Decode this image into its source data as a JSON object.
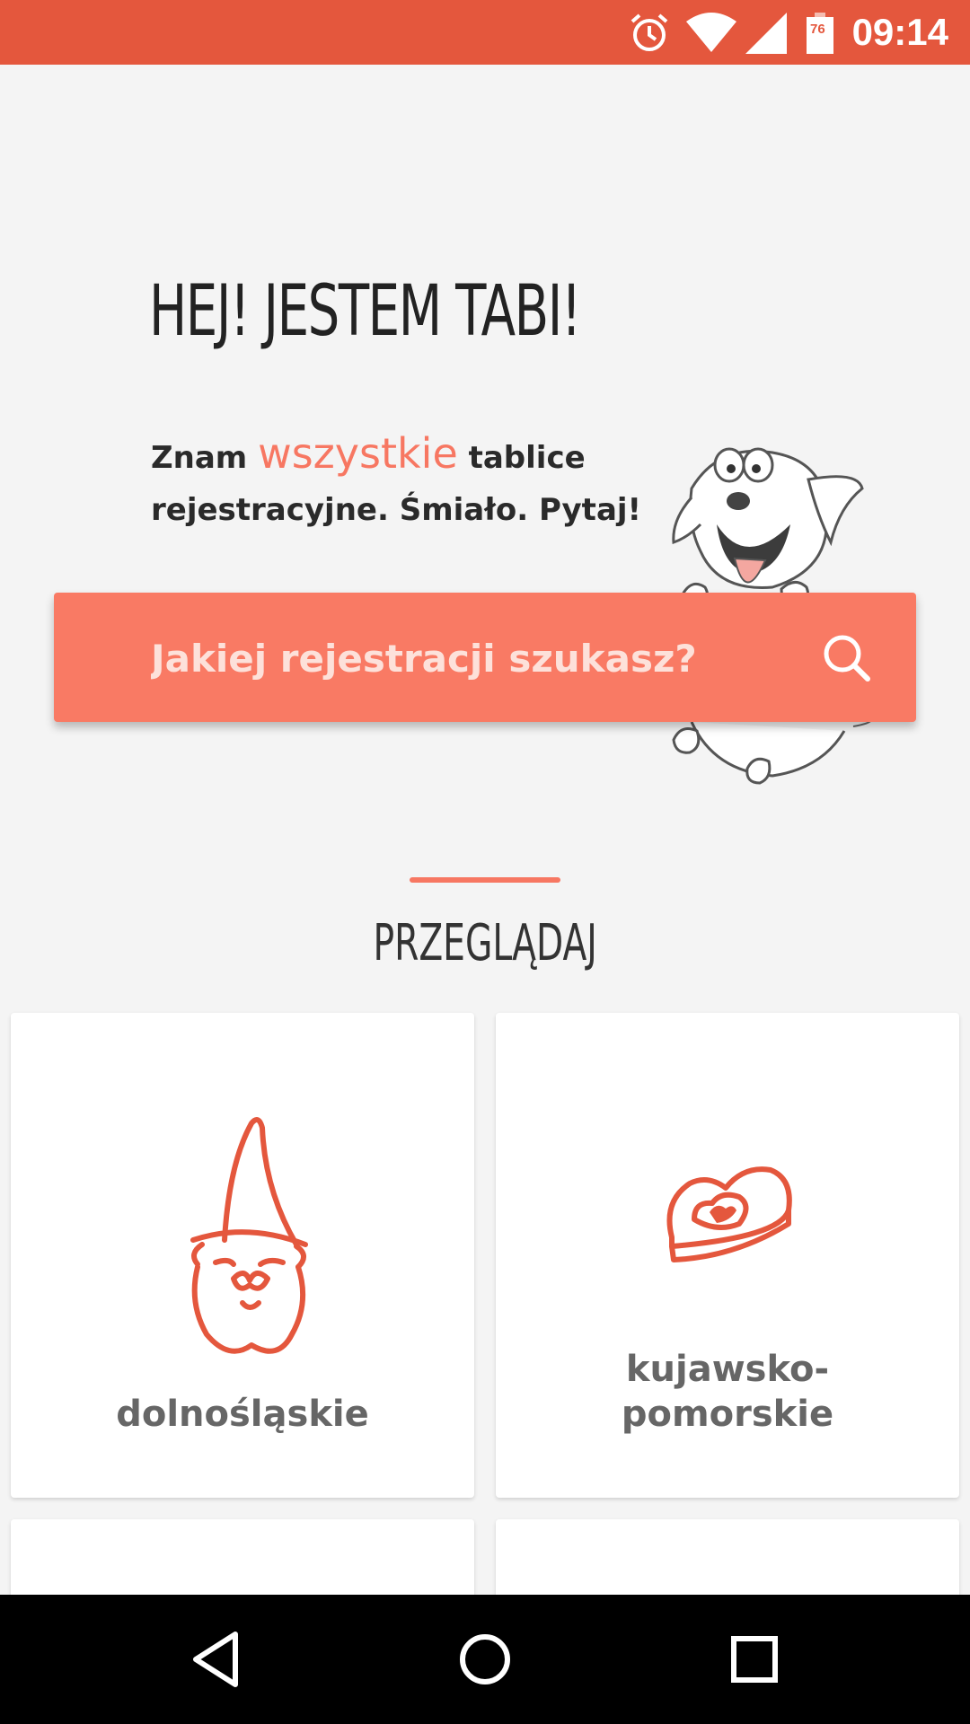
{
  "status_bar": {
    "time": "09:14",
    "battery_level": "76",
    "icons": [
      "alarm-icon",
      "wifi-icon",
      "cell-signal-icon",
      "battery-icon"
    ],
    "background": "#e4573d"
  },
  "header": {
    "headline": "HEJ! JESTEM TABI!",
    "intro_prefix": "Znam ",
    "intro_accent": "wszystkie",
    "intro_suffix": " tablice",
    "intro_line2": "rejestracyjne. Śmiało. Pytaj!"
  },
  "search": {
    "placeholder": "Jakiej rejestracji szukasz?",
    "icon": "search-icon",
    "background": "#f97a64"
  },
  "browse": {
    "title": "PRZEGLĄDAJ",
    "accent_color": "#f77762",
    "cards": [
      {
        "label": "dolnośląskie",
        "icon": "gnome-icon"
      },
      {
        "label_line1": "kujawsko-",
        "label_line2": "pomorskie",
        "icon": "heart-gingerbread-icon"
      }
    ]
  },
  "nav_bar": {
    "buttons": [
      "back-icon",
      "home-icon",
      "recents-icon"
    ]
  }
}
